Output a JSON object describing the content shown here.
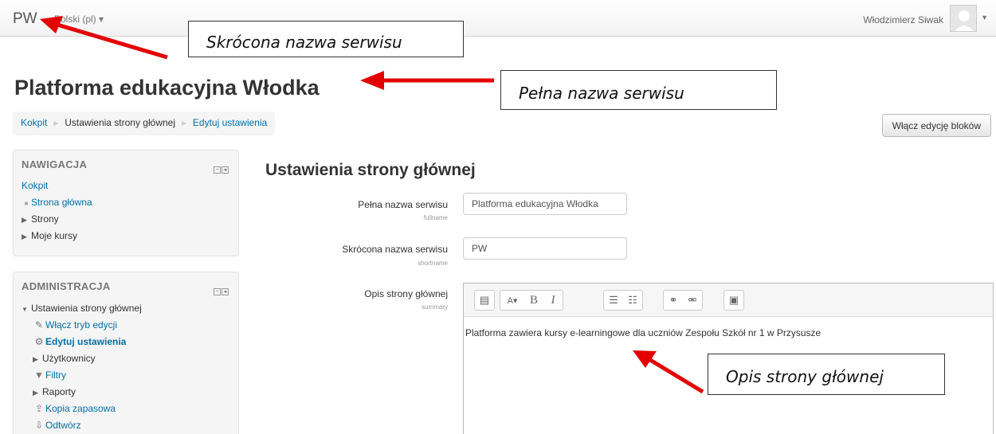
{
  "navbar": {
    "brand": "PW",
    "language": "Polski (pl) ▾",
    "user_name": "Włodzimierz Siwak",
    "user_caret": "▼"
  },
  "page_header": "Platforma edukacyjna Włodka",
  "breadcrumb": {
    "items": [
      "Kokpit",
      "Ustawienia strony głównej",
      "Edytuj ustawienia"
    ],
    "separator": "►"
  },
  "edit_blocks_button": "Włącz edycję bloków",
  "navigation_block": {
    "title": "NAWIGACJA",
    "root": "Kokpit",
    "items": [
      "Strona główna",
      "Strony",
      "Moje kursy"
    ]
  },
  "admin_block": {
    "title": "ADMINISTRACJA",
    "items": [
      "Ustawienia strony głównej",
      "Włącz tryb edycji",
      "Edytuj ustawienia",
      "Użytkownicy",
      "Filtry",
      "Raporty",
      "Kopia zapasowa",
      "Odtwórz"
    ]
  },
  "form": {
    "title": "Ustawienia strony głównej",
    "fullname": {
      "label": "Pełna nazwa serwisu",
      "sublabel": "fullname",
      "value": "Platforma edukacyjna Włodka"
    },
    "shortname": {
      "label": "Skrócona nazwa serwisu",
      "sublabel": "shortname",
      "value": "PW"
    },
    "summary": {
      "label": "Opis strony głównej",
      "sublabel": "summary",
      "text": "Platforma zawiera kursy e-learningowe dla uczniów Zespołu Szkół nr 1 w Przysusze"
    }
  },
  "annotations": {
    "shortname_note": "Skrócona nazwa serwisu",
    "fullname_note": "Pełna nazwa serwisu",
    "summary_note": "Opis strony głównej"
  },
  "colors": {
    "link": "#0070a8",
    "arrow": "#e30000"
  }
}
